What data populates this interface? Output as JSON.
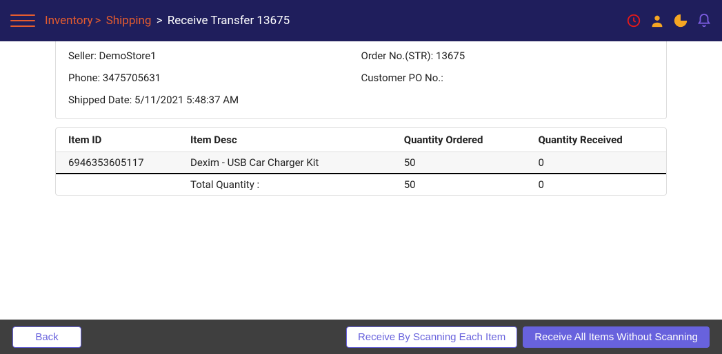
{
  "breadcrumb": {
    "link1": "Inventory",
    "link2": "Shipping",
    "current": "Receive Transfer 13675"
  },
  "info": {
    "seller_label": "Seller: ",
    "seller_value": "DemoStore1",
    "order_label": "Order No.(STR): ",
    "order_value": "13675",
    "phone_label": "Phone: ",
    "phone_value": "3475705631",
    "po_label": "Customer PO No.:",
    "po_value": "",
    "shipped_label": "Shipped Date: ",
    "shipped_value": "5/11/2021 5:48:37 AM"
  },
  "table": {
    "headers": {
      "item_id": "Item ID",
      "item_desc": "Item Desc",
      "qty_ordered": "Quantity Ordered",
      "qty_received": "Quantity Received"
    },
    "rows": [
      {
        "item_id": "6946353605117",
        "item_desc": "Dexim - USB Car Charger Kit",
        "qty_ordered": "50",
        "qty_received": "0"
      }
    ],
    "total": {
      "label": "Total Quantity :",
      "qty_ordered": "50",
      "qty_received": "0"
    }
  },
  "footer": {
    "back": "Back",
    "scan_each": "Receive By Scanning Each Item",
    "scan_all": "Receive All Items Without Scanning"
  }
}
